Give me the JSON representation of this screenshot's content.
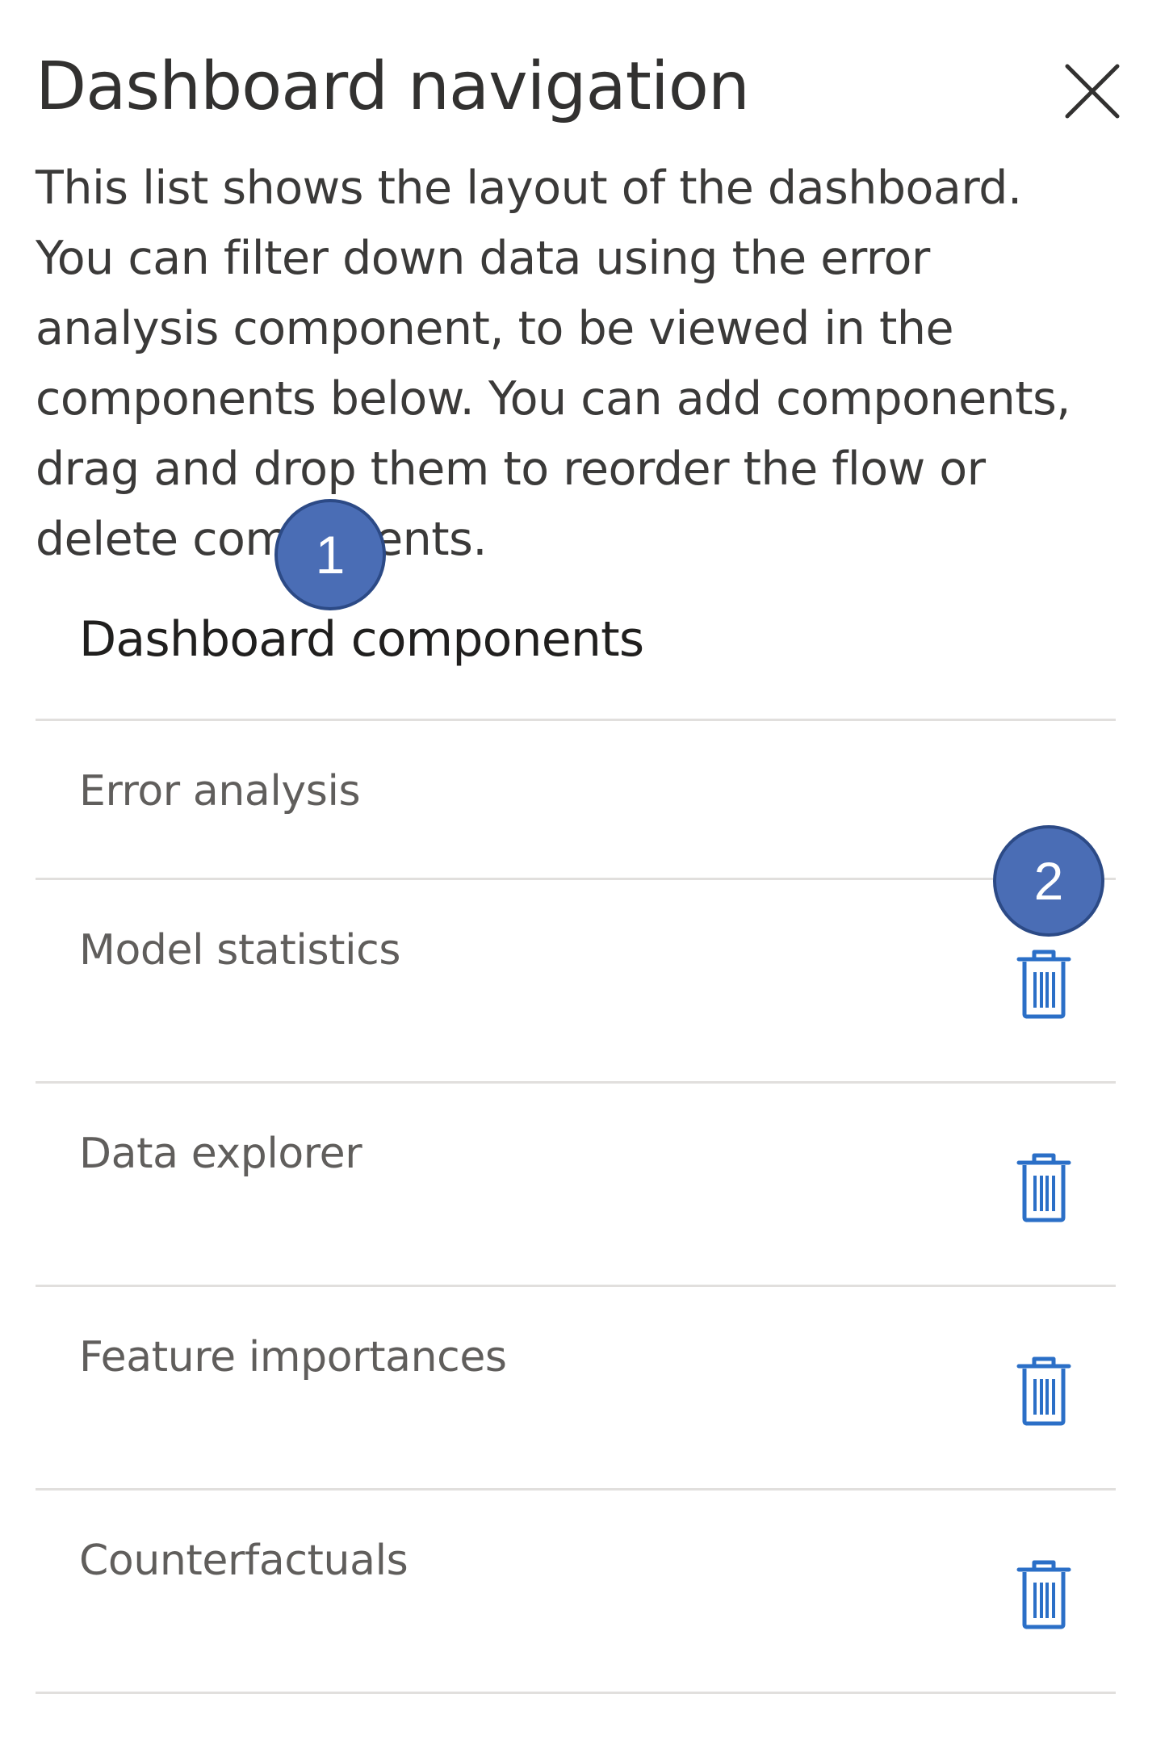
{
  "panel": {
    "title": "Dashboard navigation",
    "close_icon": "close-icon",
    "description": "This list shows the layout of the dashboard. You can filter down data using the error analysis component, to be viewed in the components below. You can add components, drag and drop them to reorder the flow or delete components."
  },
  "callouts": {
    "first": "1",
    "second": "2",
    "color": "#4a6db5"
  },
  "components": {
    "heading": "Dashboard components",
    "delete_icon": "trash-icon",
    "accent_color": "#2b6fc7",
    "items": [
      {
        "label": "Error analysis",
        "deletable": false
      },
      {
        "label": "Model statistics",
        "deletable": true
      },
      {
        "label": "Data explorer",
        "deletable": true
      },
      {
        "label": "Feature importances",
        "deletable": true
      },
      {
        "label": "Counterfactuals",
        "deletable": true
      }
    ]
  }
}
